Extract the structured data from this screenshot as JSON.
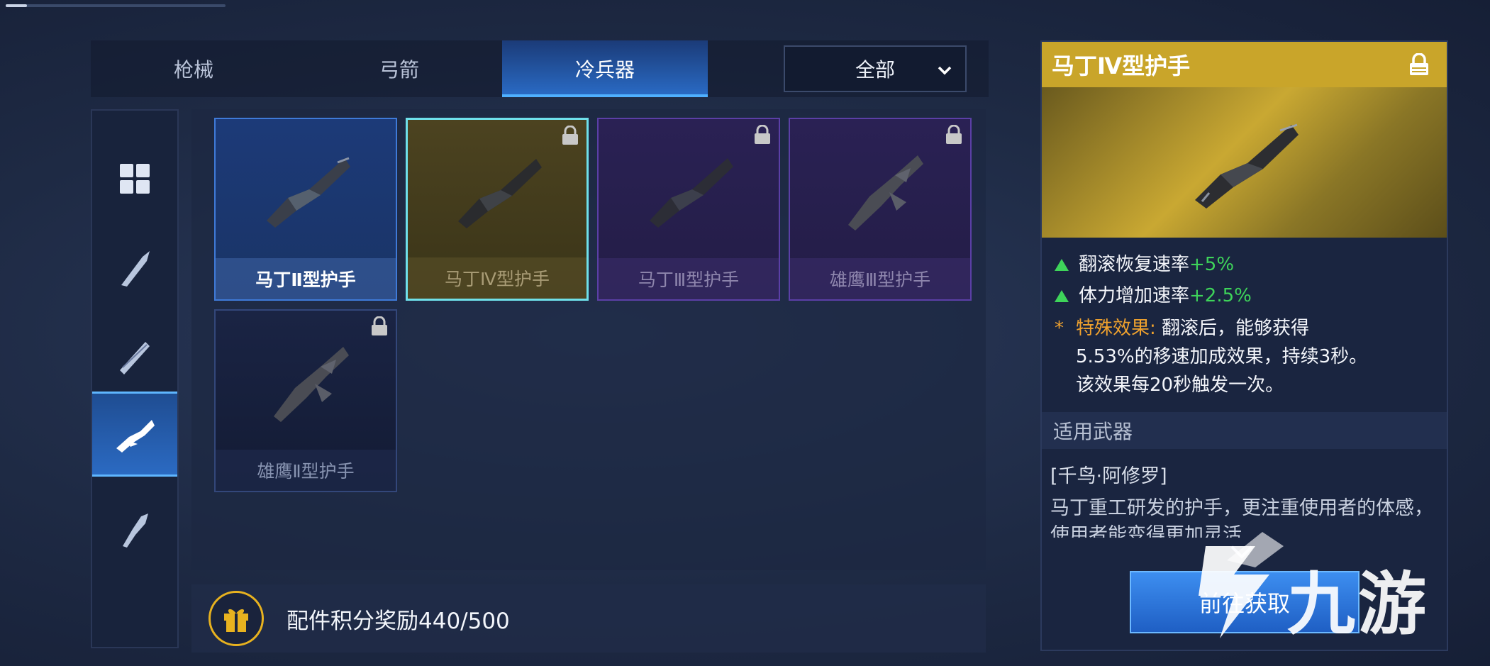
{
  "tabs": [
    {
      "label": "枪械",
      "active": false
    },
    {
      "label": "弓箭",
      "active": false
    },
    {
      "label": "冷兵器",
      "active": true
    }
  ],
  "filter": {
    "selected": "全部"
  },
  "sidebar": {
    "items": [
      {
        "icon": "grid-all-icon",
        "active": false
      },
      {
        "icon": "blade-icon",
        "active": false
      },
      {
        "icon": "double-blade-icon",
        "active": false
      },
      {
        "icon": "handguard-icon",
        "active": true
      },
      {
        "icon": "hilt-icon",
        "active": false
      }
    ]
  },
  "cards": [
    {
      "name": "马丁Ⅱ型护手",
      "rarity": "blue",
      "locked": false,
      "selected": false
    },
    {
      "name": "马丁Ⅳ型护手",
      "rarity": "gold",
      "locked": true,
      "selected": true
    },
    {
      "name": "马丁Ⅲ型护手",
      "rarity": "purple",
      "locked": true,
      "selected": false
    },
    {
      "name": "雄鹰Ⅲ型护手",
      "rarity": "purple",
      "locked": true,
      "selected": false
    },
    {
      "name": "雄鹰Ⅱ型护手",
      "rarity": "dark",
      "locked": true,
      "selected": false
    }
  ],
  "reward": {
    "text": "配件积分奖励440/500",
    "current": 440,
    "total": 500
  },
  "detail": {
    "title": "马丁Ⅳ型护手",
    "stats": [
      {
        "label": "翻滚恢复速率",
        "value": "+5%"
      },
      {
        "label": "体力增加速率",
        "value": "+2.5%"
      }
    ],
    "special_label": "特殊效果:",
    "special_line1": "翻滚后，能够获得",
    "special_line2": "5.53%的移速加成效果，持续3秒。",
    "special_line3": "该效果每20秒触发一次。",
    "section_title": "适用武器",
    "weapons": "[千鸟·阿修罗]",
    "description": "马丁重工研发的护手，更注重使用者的体感，使用者能变得更加灵活",
    "button": "前往获取"
  },
  "watermark": "九游",
  "colors": {
    "accent_blue": "#2a6cc7",
    "gold": "#c9a52a",
    "green_plus": "#3ed45a",
    "orange_special": "#f0a22e"
  }
}
